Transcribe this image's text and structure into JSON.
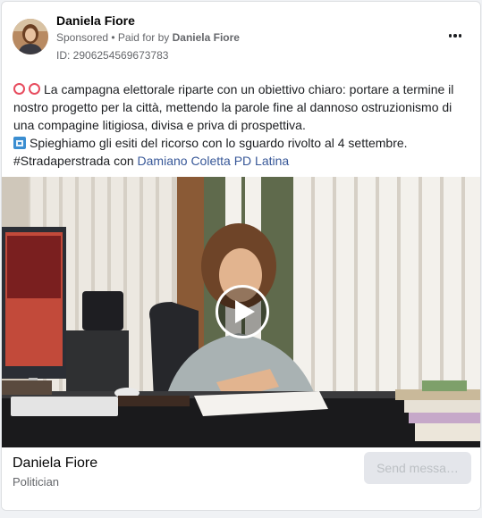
{
  "post": {
    "author": "Daniela Fiore",
    "sponsored": "Sponsored",
    "separator": " • Paid for by ",
    "paid_by": "Daniela Fiore",
    "ad_id": "ID: 2906254569673783",
    "line1": "La campagna elettorale riparte con un obiettivo chiaro: portare a termine il nostro progetto per la città, mettendo la parole fine al dannoso ostruzionismo di una compagine litigiosa, divisa e priva di prospettiva.",
    "line2": "Spieghiamo gli esiti del ricorso con lo sguardo rivolto al 4 settembre.",
    "hashtag_prefix": "#Stradaperstrada con ",
    "mention": "Damiano Coletta PD Latina"
  },
  "footer": {
    "page_name": "Daniela Fiore",
    "category": "Politician",
    "cta": "Send messa…"
  },
  "colors": {
    "link": "#385898",
    "ring_emoji": "#e74c5e",
    "calendar_emoji": "#3b8ed1"
  },
  "icons": [
    "more-options-icon",
    "red-circle-icon",
    "calendar-icon",
    "play-icon"
  ]
}
